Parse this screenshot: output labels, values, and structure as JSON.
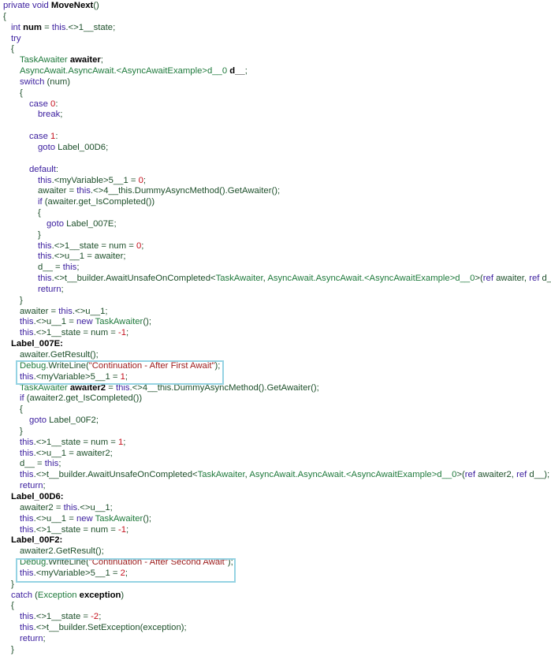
{
  "code_lines": [
    {
      "depth": 0,
      "tokens": [
        [
          "k",
          "private void "
        ],
        [
          "b",
          "MoveNext"
        ],
        [
          "p",
          "()"
        ]
      ]
    },
    {
      "depth": 0,
      "tokens": [
        [
          "p",
          "{"
        ]
      ]
    },
    {
      "depth": 1,
      "tokens": [
        [
          "k",
          "int "
        ],
        [
          "b",
          "num"
        ],
        [
          "p",
          " = "
        ],
        [
          "k",
          "this"
        ],
        [
          "p",
          ".<>1__state;"
        ]
      ]
    },
    {
      "depth": 1,
      "tokens": [
        [
          "k",
          "try"
        ]
      ]
    },
    {
      "depth": 1,
      "tokens": [
        [
          "p",
          "{"
        ]
      ]
    },
    {
      "depth": 2,
      "tokens": [
        [
          "t",
          "TaskAwaiter "
        ],
        [
          "b",
          "awaiter"
        ],
        [
          "p",
          ";"
        ]
      ]
    },
    {
      "depth": 2,
      "tokens": [
        [
          "t",
          "AsyncAwait.AsyncAwait.<AsyncAwaitExample>d__0 "
        ],
        [
          "b",
          "d__"
        ],
        [
          "p",
          ";"
        ]
      ]
    },
    {
      "depth": 2,
      "tokens": [
        [
          "k",
          "switch "
        ],
        [
          "p",
          "(num)"
        ]
      ]
    },
    {
      "depth": 2,
      "tokens": [
        [
          "p",
          "{"
        ]
      ]
    },
    {
      "depth": 3,
      "tokens": [
        [
          "k",
          "case "
        ],
        [
          "n",
          "0"
        ],
        [
          "p",
          ":"
        ]
      ]
    },
    {
      "depth": 4,
      "tokens": [
        [
          "k",
          "break"
        ],
        [
          "p",
          ";"
        ]
      ]
    },
    {
      "depth": 0,
      "tokens": []
    },
    {
      "depth": 3,
      "tokens": [
        [
          "k",
          "case "
        ],
        [
          "n",
          "1"
        ],
        [
          "p",
          ":"
        ]
      ]
    },
    {
      "depth": 4,
      "tokens": [
        [
          "k",
          "goto "
        ],
        [
          "p",
          "Label_00D6;"
        ]
      ]
    },
    {
      "depth": 0,
      "tokens": []
    },
    {
      "depth": 3,
      "tokens": [
        [
          "k",
          "default"
        ],
        [
          "p",
          ":"
        ]
      ]
    },
    {
      "depth": 4,
      "tokens": [
        [
          "k",
          "this"
        ],
        [
          "p",
          ".<myVariable>5__1 = "
        ],
        [
          "n",
          "0"
        ],
        [
          "p",
          ";"
        ]
      ]
    },
    {
      "depth": 4,
      "tokens": [
        [
          "p",
          "awaiter = "
        ],
        [
          "k",
          "this"
        ],
        [
          "p",
          ".<>4__this.DummyAsyncMethod().GetAwaiter();"
        ]
      ]
    },
    {
      "depth": 4,
      "tokens": [
        [
          "k",
          "if "
        ],
        [
          "p",
          "(awaiter.get_IsCompleted())"
        ]
      ]
    },
    {
      "depth": 4,
      "tokens": [
        [
          "p",
          "{"
        ]
      ]
    },
    {
      "depth": 5,
      "tokens": [
        [
          "k",
          "goto "
        ],
        [
          "p",
          "Label_007E;"
        ]
      ]
    },
    {
      "depth": 4,
      "tokens": [
        [
          "p",
          "}"
        ]
      ]
    },
    {
      "depth": 4,
      "tokens": [
        [
          "k",
          "this"
        ],
        [
          "p",
          ".<>1__state = num = "
        ],
        [
          "n",
          "0"
        ],
        [
          "p",
          ";"
        ]
      ]
    },
    {
      "depth": 4,
      "tokens": [
        [
          "k",
          "this"
        ],
        [
          "p",
          ".<>u__1 = awaiter;"
        ]
      ]
    },
    {
      "depth": 4,
      "tokens": [
        [
          "p",
          "d__ = "
        ],
        [
          "k",
          "this"
        ],
        [
          "p",
          ";"
        ]
      ]
    },
    {
      "depth": 4,
      "tokens": [
        [
          "k",
          "this"
        ],
        [
          "p",
          ".<>t__builder.AwaitUnsafeOnCompleted<"
        ],
        [
          "t",
          "TaskAwaiter"
        ],
        [
          "p",
          ", "
        ],
        [
          "t",
          "AsyncAwait.AsyncAwait.<AsyncAwaitExample>d__0"
        ],
        [
          "p",
          ">("
        ],
        [
          "k",
          "ref "
        ],
        [
          "p",
          "awaiter, "
        ],
        [
          "k",
          "ref "
        ],
        [
          "p",
          "d__);"
        ]
      ]
    },
    {
      "depth": 4,
      "tokens": [
        [
          "k",
          "return"
        ],
        [
          "p",
          ";"
        ]
      ]
    },
    {
      "depth": 2,
      "tokens": [
        [
          "p",
          "}"
        ]
      ]
    },
    {
      "depth": 2,
      "tokens": [
        [
          "p",
          "awaiter = "
        ],
        [
          "k",
          "this"
        ],
        [
          "p",
          ".<>u__1;"
        ]
      ]
    },
    {
      "depth": 2,
      "tokens": [
        [
          "k",
          "this"
        ],
        [
          "p",
          ".<>u__1 = "
        ],
        [
          "k",
          "new "
        ],
        [
          "t",
          "TaskAwaiter"
        ],
        [
          "p",
          "();"
        ]
      ]
    },
    {
      "depth": 2,
      "tokens": [
        [
          "k",
          "this"
        ],
        [
          "p",
          ".<>1__state = num = "
        ],
        [
          "n",
          "-1"
        ],
        [
          "p",
          ";"
        ]
      ]
    },
    {
      "depth": 1,
      "tokens": [
        [
          "b",
          "Label_007E:"
        ]
      ]
    },
    {
      "depth": 2,
      "tokens": [
        [
          "p",
          "awaiter.GetResult();"
        ]
      ]
    },
    {
      "depth": 2,
      "tokens": [
        [
          "t",
          "Debug"
        ],
        [
          "p",
          ".WriteLine("
        ],
        [
          "s",
          "\"Continuation - After First Await\""
        ],
        [
          "p",
          ");"
        ]
      ]
    },
    {
      "depth": 2,
      "tokens": [
        [
          "k",
          "this"
        ],
        [
          "p",
          ".<myVariable>5__1 = "
        ],
        [
          "n",
          "1"
        ],
        [
          "p",
          ";"
        ]
      ]
    },
    {
      "depth": 2,
      "tokens": [
        [
          "t",
          "TaskAwaiter "
        ],
        [
          "b",
          "awaiter2"
        ],
        [
          "p",
          " = "
        ],
        [
          "k",
          "this"
        ],
        [
          "p",
          ".<>4__this.DummyAsyncMethod().GetAwaiter();"
        ]
      ]
    },
    {
      "depth": 2,
      "tokens": [
        [
          "k",
          "if "
        ],
        [
          "p",
          "(awaiter2.get_IsCompleted())"
        ]
      ]
    },
    {
      "depth": 2,
      "tokens": [
        [
          "p",
          "{"
        ]
      ]
    },
    {
      "depth": 3,
      "tokens": [
        [
          "k",
          "goto "
        ],
        [
          "p",
          "Label_00F2;"
        ]
      ]
    },
    {
      "depth": 2,
      "tokens": [
        [
          "p",
          "}"
        ]
      ]
    },
    {
      "depth": 2,
      "tokens": [
        [
          "k",
          "this"
        ],
        [
          "p",
          ".<>1__state = num = "
        ],
        [
          "n",
          "1"
        ],
        [
          "p",
          ";"
        ]
      ]
    },
    {
      "depth": 2,
      "tokens": [
        [
          "k",
          "this"
        ],
        [
          "p",
          ".<>u__1 = awaiter2;"
        ]
      ]
    },
    {
      "depth": 2,
      "tokens": [
        [
          "p",
          "d__ = "
        ],
        [
          "k",
          "this"
        ],
        [
          "p",
          ";"
        ]
      ]
    },
    {
      "depth": 2,
      "tokens": [
        [
          "k",
          "this"
        ],
        [
          "p",
          ".<>t__builder.AwaitUnsafeOnCompleted<"
        ],
        [
          "t",
          "TaskAwaiter"
        ],
        [
          "p",
          ", "
        ],
        [
          "t",
          "AsyncAwait.AsyncAwait.<AsyncAwaitExample>d__0"
        ],
        [
          "p",
          ">("
        ],
        [
          "k",
          "ref "
        ],
        [
          "p",
          "awaiter2, "
        ],
        [
          "k",
          "ref "
        ],
        [
          "p",
          "d__);"
        ]
      ]
    },
    {
      "depth": 2,
      "tokens": [
        [
          "k",
          "return"
        ],
        [
          "p",
          ";"
        ]
      ]
    },
    {
      "depth": 1,
      "tokens": [
        [
          "b",
          "Label_00D6:"
        ]
      ]
    },
    {
      "depth": 2,
      "tokens": [
        [
          "p",
          "awaiter2 = "
        ],
        [
          "k",
          "this"
        ],
        [
          "p",
          ".<>u__1;"
        ]
      ]
    },
    {
      "depth": 2,
      "tokens": [
        [
          "k",
          "this"
        ],
        [
          "p",
          ".<>u__1 = "
        ],
        [
          "k",
          "new "
        ],
        [
          "t",
          "TaskAwaiter"
        ],
        [
          "p",
          "();"
        ]
      ]
    },
    {
      "depth": 2,
      "tokens": [
        [
          "k",
          "this"
        ],
        [
          "p",
          ".<>1__state = num = "
        ],
        [
          "n",
          "-1"
        ],
        [
          "p",
          ";"
        ]
      ]
    },
    {
      "depth": 1,
      "tokens": [
        [
          "b",
          "Label_00F2:"
        ]
      ]
    },
    {
      "depth": 2,
      "tokens": [
        [
          "p",
          "awaiter2.GetResult();"
        ]
      ]
    },
    {
      "depth": 2,
      "tokens": [
        [
          "t",
          "Debug"
        ],
        [
          "p",
          ".WriteLine("
        ],
        [
          "s",
          "\"Continuation - After Second Await\""
        ],
        [
          "p",
          ");"
        ]
      ]
    },
    {
      "depth": 2,
      "tokens": [
        [
          "k",
          "this"
        ],
        [
          "p",
          ".<myVariable>5__1 = "
        ],
        [
          "n",
          "2"
        ],
        [
          "p",
          ";"
        ]
      ]
    },
    {
      "depth": 1,
      "tokens": [
        [
          "p",
          "}"
        ]
      ]
    },
    {
      "depth": 1,
      "tokens": [
        [
          "k",
          "catch "
        ],
        [
          "p",
          "("
        ],
        [
          "t",
          "Exception "
        ],
        [
          "b",
          "exception"
        ],
        [
          "p",
          ")"
        ]
      ]
    },
    {
      "depth": 1,
      "tokens": [
        [
          "p",
          "{"
        ]
      ]
    },
    {
      "depth": 2,
      "tokens": [
        [
          "k",
          "this"
        ],
        [
          "p",
          ".<>1__state = "
        ],
        [
          "n",
          "-2"
        ],
        [
          "p",
          ";"
        ]
      ]
    },
    {
      "depth": 2,
      "tokens": [
        [
          "k",
          "this"
        ],
        [
          "p",
          ".<>t__builder.SetException(exception);"
        ]
      ]
    },
    {
      "depth": 2,
      "tokens": [
        [
          "k",
          "return"
        ],
        [
          "p",
          ";"
        ]
      ]
    },
    {
      "depth": 1,
      "tokens": [
        [
          "p",
          "}"
        ]
      ]
    }
  ],
  "highlight_color": "#95d3e3"
}
